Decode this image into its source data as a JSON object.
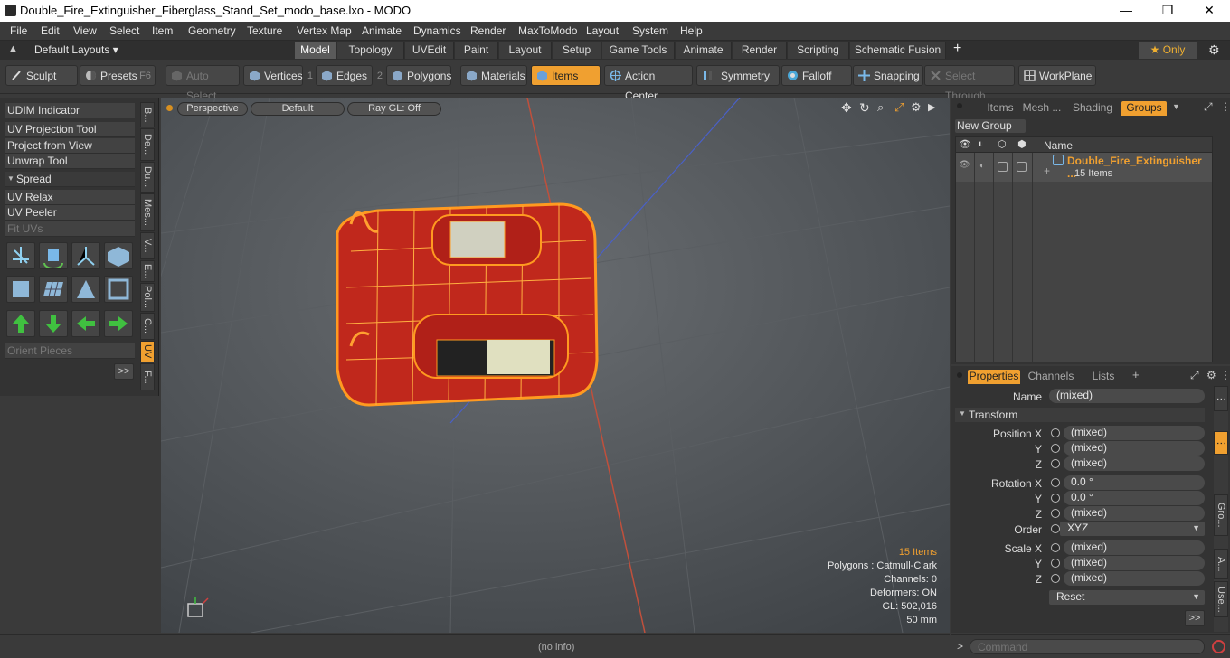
{
  "window": {
    "title": "Double_Fire_Extinguisher_Fiberglass_Stand_Set_modo_base.lxo - MODO",
    "minimize": "—",
    "maximize": "❐",
    "close": "✕"
  },
  "menu": [
    "File",
    "Edit",
    "View",
    "Select",
    "Item",
    "Geometry",
    "Texture",
    "Vertex Map",
    "Animate",
    "Dynamics",
    "Render",
    "MaxToModo",
    "Layout",
    "System",
    "Help"
  ],
  "layouts": {
    "label": "Default Layouts ▾"
  },
  "tabs": [
    "Model",
    "Topology",
    "UVEdit",
    "Paint",
    "Layout",
    "Setup",
    "Game Tools",
    "Animate",
    "Render",
    "Scripting",
    "Schematic Fusion"
  ],
  "tab_add": "+",
  "only_label": "★ Only",
  "toolbar": {
    "sculpt": "Sculpt",
    "presets": "Presets",
    "presets_key": "F6",
    "auto_select": "Auto Select",
    "vertices": "Vertices",
    "vertices_num": "1",
    "edges": "Edges",
    "edges_num": "2",
    "polygons": "Polygons",
    "materials": "Materials",
    "items": "Items",
    "action_center": "Action Center",
    "symmetry": "Symmetry",
    "falloff": "Falloff",
    "snapping": "Snapping",
    "select_through": "Select Through",
    "workplane": "WorkPlane"
  },
  "left": {
    "items": [
      "UDIM Indicator",
      "UV Projection Tool",
      "Project from View",
      "Unwrap Tool"
    ],
    "spread": "Spread",
    "items2": [
      "UV Relax",
      "UV Peeler"
    ],
    "fit_uvs": "Fit UVs",
    "orient": "Orient Pieces",
    "more": ">>",
    "vtabs": [
      "B...",
      "De...",
      "Du...",
      "Mes...",
      "V...",
      "E...",
      "Pol...",
      "C...",
      "UV",
      "F..."
    ]
  },
  "viewport": {
    "perspective": "Perspective",
    "default": "Default",
    "raygl": "Ray GL: Off",
    "stats": {
      "items": "15 Items",
      "polygons": "Polygons : Catmull-Clark",
      "channels": "Channels: 0",
      "deformers": "Deformers: ON",
      "gl": "GL: 502,016",
      "scale": "50 mm"
    }
  },
  "status": {
    "info": "(no info)"
  },
  "rightTop": {
    "tabs": [
      "Items",
      "Mesh ...",
      "Shading",
      "Groups"
    ],
    "new_group": "New Group",
    "col_name": "Name",
    "group_name": "Double_Fire_Extinguisher ...",
    "group_count": "15 Items"
  },
  "rightBot": {
    "tabs": [
      "Properties",
      "Channels",
      "Lists"
    ],
    "add": "+",
    "name_label": "Name",
    "name_value": "(mixed)",
    "transform": "Transform",
    "position_label": "Position X",
    "y": "Y",
    "z": "Z",
    "pos": [
      "(mixed)",
      "(mixed)",
      "(mixed)"
    ],
    "rotation_label": "Rotation X",
    "rot": [
      "0.0 °",
      "0.0 °",
      "(mixed)"
    ],
    "order_label": "Order",
    "order_value": "XYZ",
    "scale_label": "Scale X",
    "scale": [
      "(mixed)",
      "(mixed)",
      "(mixed)"
    ],
    "reset": "Reset",
    "more": ">>",
    "side_tabs": [
      "Gro...",
      "A...",
      "Use..."
    ]
  },
  "command": {
    "prompt": ">",
    "placeholder": "Command"
  }
}
